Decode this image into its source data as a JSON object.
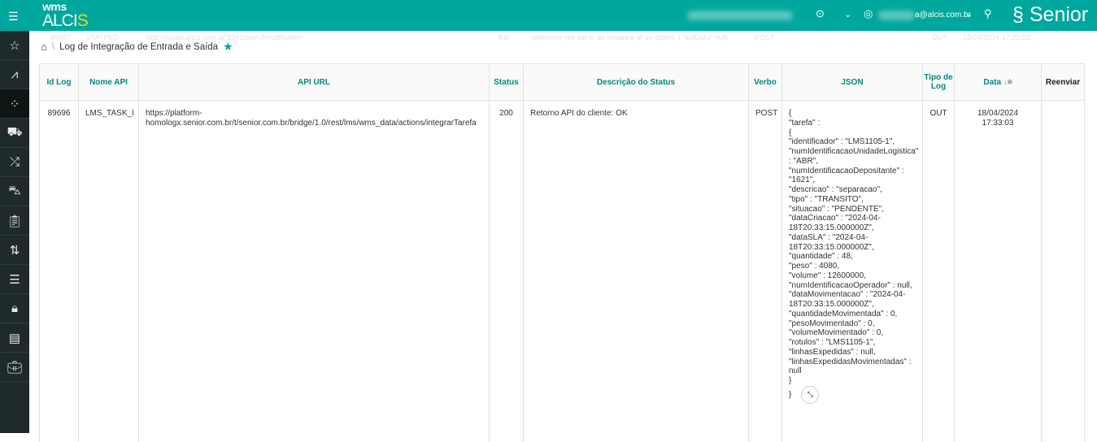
{
  "header": {
    "logo_top": "wms",
    "logo_main": "ALCI",
    "logo_s": "S",
    "email": "a@alcis.com.br",
    "brand": "Senior"
  },
  "sidebar": [
    "star",
    "chart",
    "apps",
    "truck",
    "shuffle",
    "delivery",
    "clipboard",
    "sync",
    "checklist",
    "lock",
    "archive",
    "briefcase"
  ],
  "ghost_row": {
    "id": "89697",
    "name": "STATPED",
    "url": "http://ociapi.alcis.com.br:3341/api/v2/notification",
    "status": "400",
    "desc": "reference not set to an instance of an object. | \"apiData\":null|",
    "verb": "POST",
    "type": "OUT",
    "date": "18/04/2024 17:33:23"
  },
  "breadcrumb": {
    "title": "Log de Integração de Entrada e Saída"
  },
  "columns": [
    "Id Log",
    "Nome API",
    "API URL",
    "Status",
    "Descrição do Status",
    "Verbo",
    "JSON",
    "Tipo de Log",
    "Data",
    "Reenviar"
  ],
  "row": {
    "id": "89696",
    "name": "LMS_TASK_I",
    "url_1": "https://platform-",
    "url_2": "homologx.senior.com.br/t/senior.com.br/bridge/1.0/rest/lms/wms_data/actions/integrarTarefa",
    "status": "200",
    "desc": "Retorno API do cliente: OK",
    "verb": "POST",
    "type": "OUT",
    "date": "18/04/2024 17:33:03",
    "json": [
      "{",
      "\"tarefa\" :",
      "{",
      "\"identificador\" : \"LMS1105-1\",",
      "\"numIdentificacaoUnidadeLogistica\"",
      ": \"ABR\",",
      "\"numIdentificacaoDepositante\" :",
      "\"1621\",",
      "\"descricao\" : \"separacao\",",
      "\"tipo\" : \"TRANSITO\",",
      "\"situacao\" : \"PENDENTE\",",
      "\"dataCriacao\" : \"2024-04-",
      "18T20:33:15.000000Z\",",
      "\"dataSLA\" : \"2024-04-",
      "18T20:33:15.000000Z\",",
      "\"quantidade\" : 48,",
      "\"peso\" : 4080,",
      "\"volume\" : 12600000,",
      "\"numIdentificacaoOperador\" : null,",
      "\"dataMovimentacao\" : \"2024-04-",
      "18T20:33:15.000000Z\",",
      "\"quantidadeMovimentada\" : 0,",
      "\"pesoMovimentado\" : 0,",
      "\"volumeMovimentado\" : 0,",
      "\"rotulos\" : \"LMS1105-1\",",
      "\"linhasExpedidas\" : null,",
      "\"linhasExpedidasMovimentadas\" :",
      "null",
      "}",
      "}"
    ]
  }
}
